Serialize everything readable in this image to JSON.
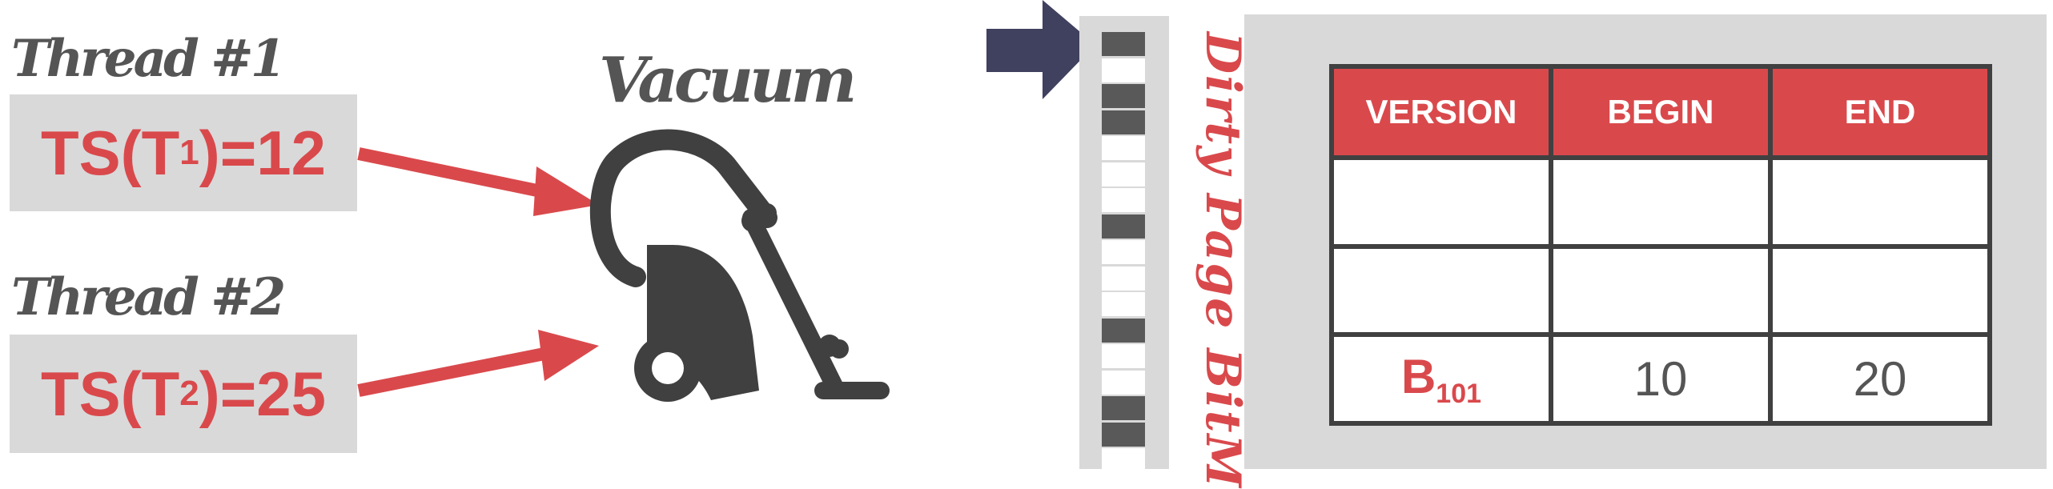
{
  "threads": [
    {
      "title": "Thread #1",
      "ts_prefix": "TS(T",
      "ts_sub": "1",
      "ts_suffix": ")=12"
    },
    {
      "title": "Thread #2",
      "ts_prefix": "TS(T",
      "ts_sub": "2",
      "ts_suffix": ")=25"
    }
  ],
  "vacuum": {
    "title": "Vacuum",
    "icon": "vacuum-cleaner-icon"
  },
  "bitmap": {
    "label": "Dirty Page BitM",
    "bits": [
      1,
      0,
      1,
      1,
      0,
      0,
      0,
      1,
      0,
      0,
      0,
      1,
      0,
      0,
      1,
      1,
      0
    ]
  },
  "table": {
    "headers": [
      "VERSION",
      "BEGIN",
      "END"
    ],
    "rows": [
      {
        "version": "",
        "version_sub": "",
        "begin": "",
        "end": ""
      },
      {
        "version": "",
        "version_sub": "",
        "begin": "",
        "end": ""
      },
      {
        "version": "B",
        "version_sub": "101",
        "begin": "10",
        "end": "20"
      }
    ]
  },
  "colors": {
    "accent_red": "#d9494c",
    "panel_gray": "#d9d9d9",
    "dark_gray": "#404040",
    "navy_arrow": "#40405f"
  }
}
